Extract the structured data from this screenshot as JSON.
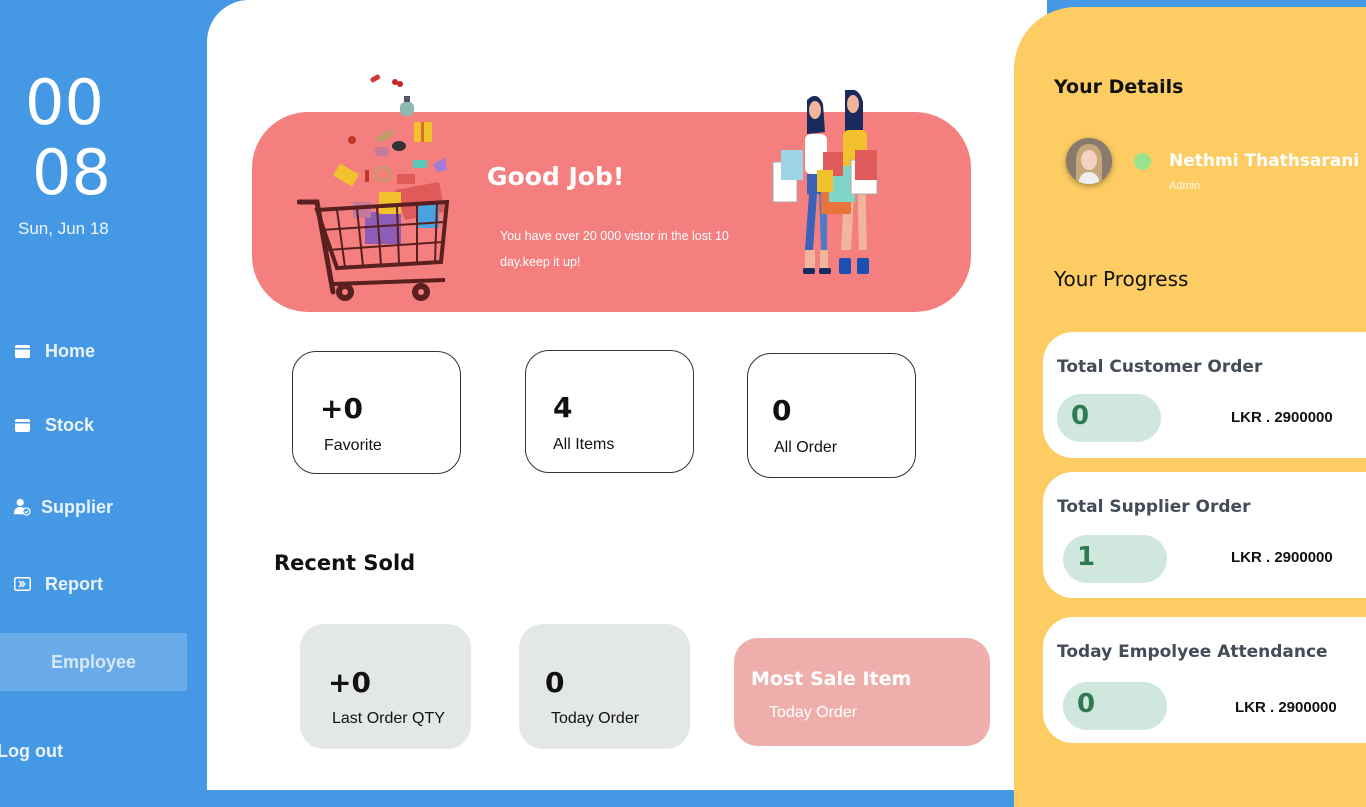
{
  "clock": {
    "hours": "00",
    "minutes": "08",
    "date": "Sun, Jun 18"
  },
  "sidebar": {
    "items": [
      {
        "label": "Home",
        "icon": "home-icon"
      },
      {
        "label": "Stock",
        "icon": "stock-icon"
      },
      {
        "label": "Supplier",
        "icon": "supplier-icon"
      },
      {
        "label": "Report",
        "icon": "report-icon"
      },
      {
        "label": "Employee",
        "icon": "employee-icon",
        "active": true
      }
    ],
    "logout_label": "Log out"
  },
  "banner": {
    "title": "Good Job!",
    "message": "You have over 20 000 vistor in the lost 10 day.keep it up!"
  },
  "stats": [
    {
      "value": "+0",
      "label": "Favorite"
    },
    {
      "value": "4",
      "label": "All Items"
    },
    {
      "value": "0",
      "label": "All Order"
    }
  ],
  "recent_sold": {
    "title": "Recent Sold",
    "cards": [
      {
        "value": "+0",
        "label": "Last Order QTY"
      },
      {
        "value": "0",
        "label": "Today Order"
      }
    ],
    "most_sale": {
      "title": "Most Sale Item",
      "subtitle": "Today Order"
    }
  },
  "details": {
    "title": "Your Details",
    "user_name": "Nethmi Thathsarani",
    "user_role": "Admin",
    "progress_title": "Your Progress"
  },
  "progress": [
    {
      "title": "Total Customer Order",
      "count": "0",
      "amount": "LKR . 2900000"
    },
    {
      "title": "Total Supplier Order",
      "count": "1",
      "amount": "LKR . 2900000"
    },
    {
      "title": "Today Empolyee Attendance",
      "count": "0",
      "amount": "LKR . 2900000"
    }
  ],
  "colors": {
    "sidebar": "#4498e4",
    "banner": "#f57f7f",
    "right_panel": "#fdcc62",
    "most_sale_card": "#eeaeab",
    "count_pill": "#cfe7dc",
    "online_status": "#9be48f"
  }
}
